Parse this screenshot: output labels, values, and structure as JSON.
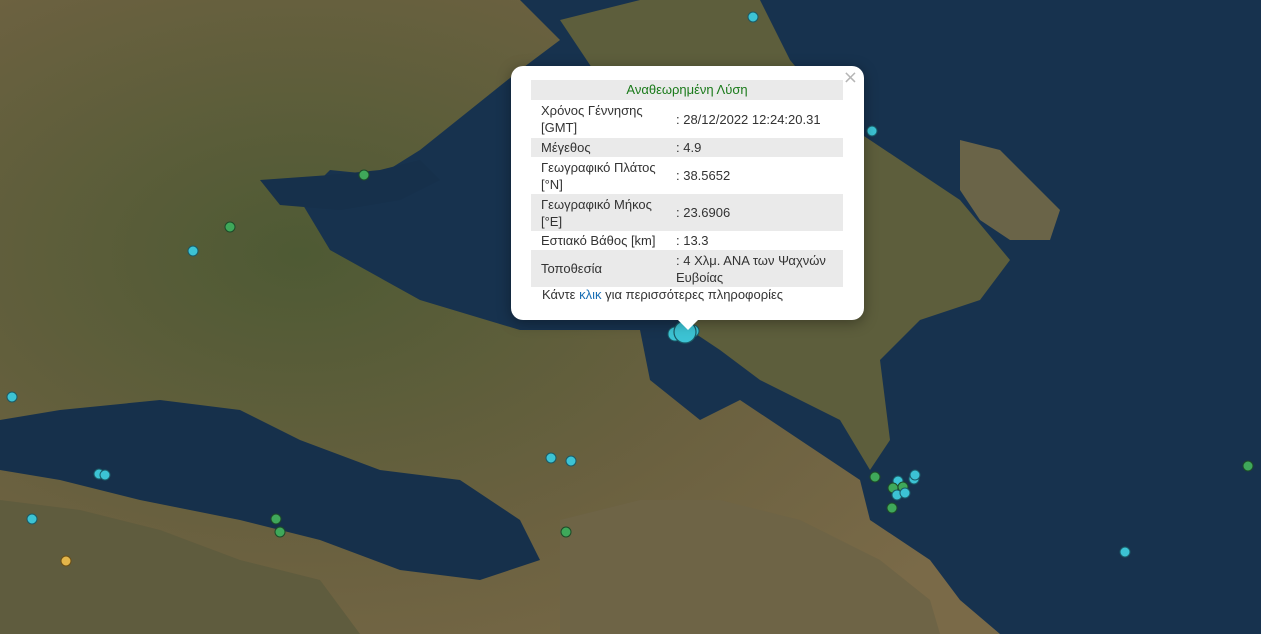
{
  "popup": {
    "title": "Αναθεωρημένη Λύση",
    "close_symbol": "×",
    "rows": [
      {
        "key": "Χρόνος Γέννησης [GMT]",
        "value": ": 28/12/2022 12:24:20.31"
      },
      {
        "key": "Μέγεθος",
        "value": ": 4.9"
      },
      {
        "key": "Γεωγραφικό Πλάτος [°N]",
        "value": ": 38.5652"
      },
      {
        "key": "Γεωγραφικό Μήκος [°E]",
        "value": ": 23.6906"
      },
      {
        "key": "Εστιακό Βάθος [km]",
        "value": ": 13.3"
      },
      {
        "key": "Τοποθεσία",
        "value": ": 4 Χλμ. ΑΝΑ των Ψαχνών Ευβοίας"
      }
    ],
    "more_prefix": "Κάντε ",
    "more_link": "κλικ",
    "more_suffix": " για περισσότερες πληροφορίες"
  },
  "colors": {
    "sea": "#17324e",
    "land": "#5b5a3a",
    "marker_cyan": "#3cc3d4",
    "marker_green": "#3fa85a",
    "marker_yellow": "#e3b54a",
    "popup_title": "#1a7a1a",
    "link": "#1a6fb5"
  }
}
